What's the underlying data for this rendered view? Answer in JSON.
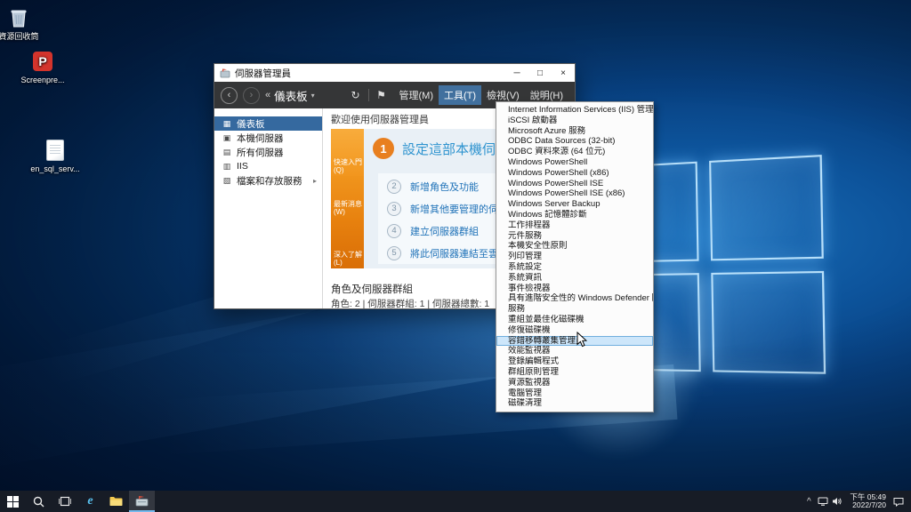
{
  "desktop": {
    "icons": [
      {
        "label": "資源回收筒"
      },
      {
        "label": "Screenpre...",
        "badge": "P"
      },
      {
        "label": "en_sql_serv..."
      }
    ]
  },
  "server_manager": {
    "title": "伺服器管理員",
    "titlebar_icons": {
      "minimize": "─",
      "maximize": "□",
      "close": "×"
    },
    "toolbar": {
      "back_icon": "‹",
      "forward_icon": "›",
      "breadcrumb_collapse": "«",
      "breadcrumb": "儀表板",
      "dropdown_arrow": "▾",
      "refresh_icon": "↻",
      "flag_icon": "⚑",
      "menus": [
        {
          "label": "管理(M)"
        },
        {
          "label": "工具(T)",
          "state": "highlighted"
        },
        {
          "label": "檢視(V)"
        },
        {
          "label": "說明(H)"
        }
      ]
    },
    "sidebar": {
      "items": [
        {
          "label": "儀表板",
          "glyph": "▦",
          "state": "selected"
        },
        {
          "label": "本機伺服器",
          "glyph": "▣"
        },
        {
          "label": "所有伺服器",
          "glyph": "▤"
        },
        {
          "label": "IIS",
          "glyph": "▥"
        },
        {
          "label": "檔案和存放服務",
          "glyph": "▧",
          "arrow": "▸"
        }
      ]
    },
    "welcome": {
      "heading": "歡迎使用伺服器管理員",
      "quickstart_labels": [
        "快速入門(Q)",
        "最新消息(W)",
        "深入了解(L)"
      ],
      "step1": {
        "n": "1",
        "label": "設定這部本機伺服器"
      },
      "steps": [
        {
          "n": "2",
          "label": "新增角色及功能"
        },
        {
          "n": "3",
          "label": "新增其他要管理的伺服器"
        },
        {
          "n": "4",
          "label": "建立伺服器群組"
        },
        {
          "n": "5",
          "label": "將此伺服器連結至雲端服務"
        }
      ]
    },
    "roles_section": {
      "heading": "角色及伺服器群組",
      "summary": "角色: 2 | 伺服器群組: 1 | 伺服器總數: 1"
    }
  },
  "tools_menu": {
    "items": [
      {
        "label": "Internet Information Services (IIS) 管理員"
      },
      {
        "label": "iSCSI 啟動器"
      },
      {
        "label": "Microsoft Azure 服務"
      },
      {
        "label": "ODBC Data Sources (32-bit)"
      },
      {
        "label": "ODBC 資料來源 (64 位元)"
      },
      {
        "label": "Windows PowerShell"
      },
      {
        "label": "Windows PowerShell (x86)"
      },
      {
        "label": "Windows PowerShell ISE"
      },
      {
        "label": "Windows PowerShell ISE (x86)"
      },
      {
        "label": "Windows Server Backup"
      },
      {
        "label": "Windows 記憶體診斷"
      },
      {
        "label": "工作排程器"
      },
      {
        "label": "元件服務"
      },
      {
        "label": "本機安全性原則"
      },
      {
        "label": "列印管理"
      },
      {
        "label": "系統設定"
      },
      {
        "label": "系統資訊"
      },
      {
        "label": "事件檢視器"
      },
      {
        "label": "具有進階安全性的 Windows Defender 防火牆"
      },
      {
        "label": "服務"
      },
      {
        "label": "重組並最佳化磁碟機"
      },
      {
        "label": "修復磁碟機"
      },
      {
        "label": "容錯移轉叢集管理員",
        "state": "highlighted"
      },
      {
        "label": "效能監視器"
      },
      {
        "label": "登錄編輯程式"
      },
      {
        "label": "群組原則管理"
      },
      {
        "label": "資源監視器"
      },
      {
        "label": "電腦管理"
      },
      {
        "label": "磁碟清理"
      }
    ]
  },
  "taskbar": {
    "ie_glyph": "e",
    "tray_chevron": "^",
    "clock": {
      "time": "下午 05:49",
      "date": "2022/7/20"
    }
  }
}
